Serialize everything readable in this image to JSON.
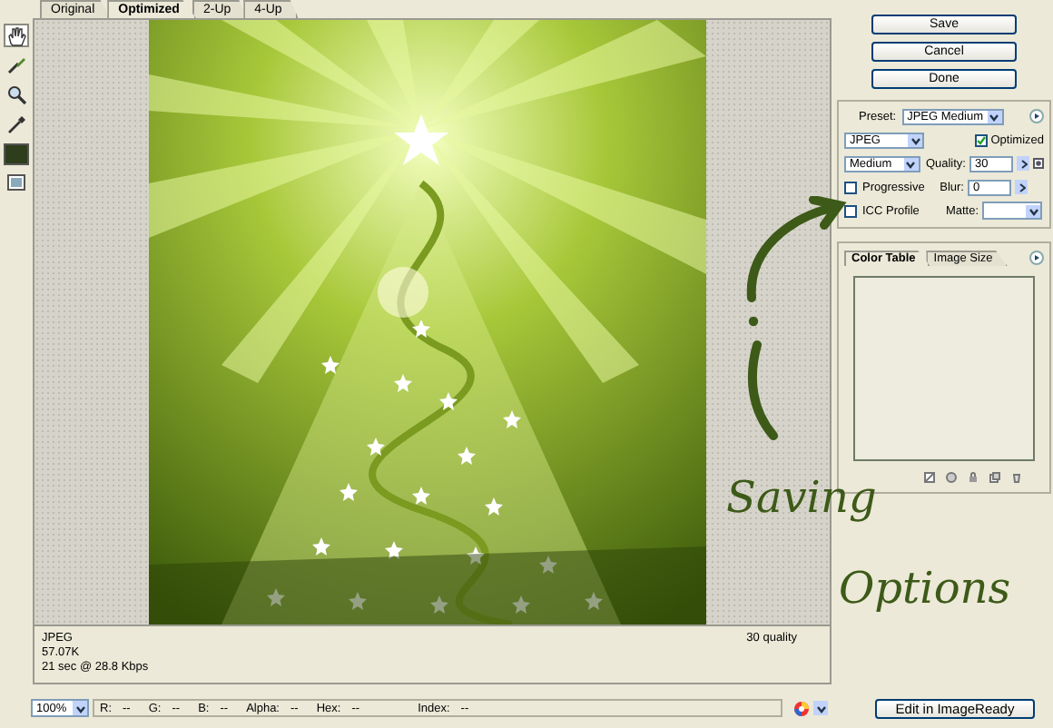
{
  "tools": [
    {
      "kind": "hand",
      "selected": true
    },
    {
      "kind": "slice_select",
      "selected": false
    },
    {
      "kind": "zoom",
      "selected": false
    },
    {
      "kind": "eyedropper",
      "selected": false
    },
    {
      "kind": "swatch",
      "selected": false
    },
    {
      "kind": "slice_toggle",
      "selected": false
    }
  ],
  "tabs": [
    {
      "label": "Original",
      "selected": false
    },
    {
      "label": "Optimized",
      "selected": true
    },
    {
      "label": "2-Up",
      "selected": false
    },
    {
      "label": "4-Up",
      "selected": false
    }
  ],
  "preview": {
    "kind": "picture"
  },
  "image_info": {
    "format": "JPEG",
    "size": "57.07K",
    "download_time": "21 sec @ 28.8 Kbps",
    "quality": "30 quality"
  },
  "buttons": [
    "Save",
    "Cancel",
    "Done"
  ],
  "settings": {
    "preset_label": "Preset:",
    "preset": "JPEG Medium",
    "format": "JPEG",
    "quality_level": "Medium",
    "optimized": {
      "label": "Optimized",
      "checked": true
    },
    "progressive": {
      "label": "Progressive",
      "checked": false
    },
    "icc_profile": {
      "label": "ICC Profile",
      "checked": false
    },
    "quality_label": "Quality:",
    "quality": "30",
    "blur_label": "Blur:",
    "blur": "0",
    "matte_label": "Matte:"
  },
  "color_panel": {
    "tabs": [
      {
        "label": "Color Table",
        "selected": true
      },
      {
        "label": "Image Size",
        "selected": false
      }
    ]
  },
  "status_bar": {
    "zoom": "100%",
    "readouts": [
      {
        "label": "R:",
        "value": "--"
      },
      {
        "label": "G:",
        "value": "--"
      },
      {
        "label": "B:",
        "value": "--"
      },
      {
        "label": "Alpha:",
        "value": "--"
      },
      {
        "label": "Hex:",
        "value": "--"
      },
      {
        "label": "Index:",
        "value": "--"
      }
    ]
  },
  "edit_button": "Edit in ImageReady",
  "annotation": {
    "line_1": "Saving",
    "line_2": "Options"
  }
}
